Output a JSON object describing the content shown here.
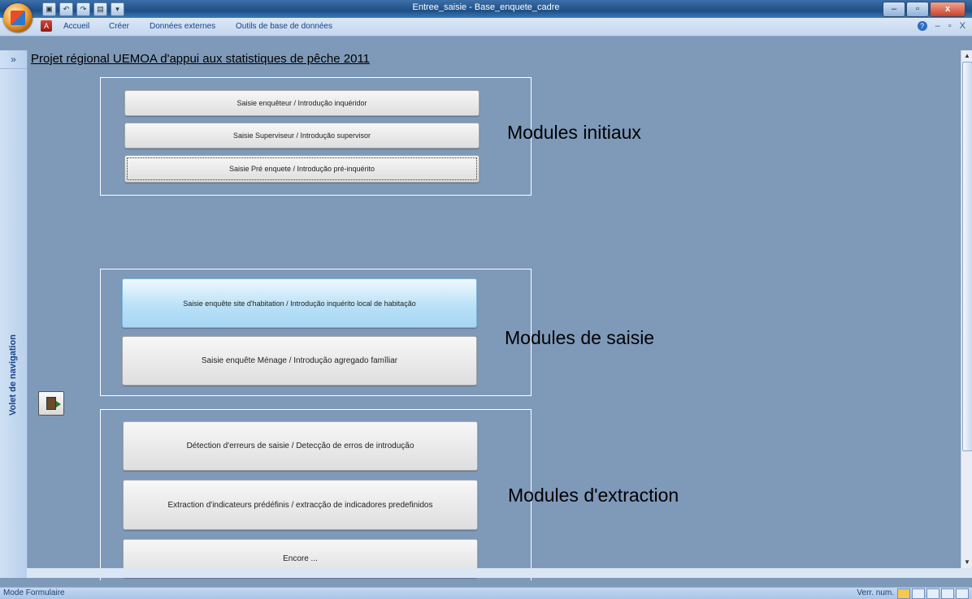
{
  "window": {
    "title": "Entree_saisie - Base_enquete_cadre"
  },
  "ribbon": {
    "tabs": [
      "Accueil",
      "Créer",
      "Données externes",
      "Outils de base de données"
    ]
  },
  "nav_pane": {
    "label": "Volet de navigation",
    "toggle": "»"
  },
  "form": {
    "title": "Projet régional UEMOA d'appui aux statistiques de pêche 2011",
    "initial": {
      "label": "Modules initiaux",
      "buttons": [
        "Saisie enquêteur / Introdução inquéridor",
        "Saisie Superviseur / Introdução supervisor",
        "Saisie Pré enquete / Introdução pré-inquérito"
      ]
    },
    "entry": {
      "label": "Modules de saisie",
      "buttons": [
        "Saisie enquête site d'habitation / Introdução inquérito local de habitação",
        "Saisie enquête Ménage / Introdução agregado famîliar"
      ]
    },
    "extraction": {
      "label": "Modules d'extraction",
      "buttons": [
        "Détection d'erreurs de saisie / Detecção de erros de introdução",
        "Extraction d'indicateurs prédéfinis / extracção de indicadores predefinidos",
        "Encore ..."
      ]
    }
  },
  "statusbar": {
    "mode": "Mode Formulaire",
    "numlock": "Verr. num."
  }
}
